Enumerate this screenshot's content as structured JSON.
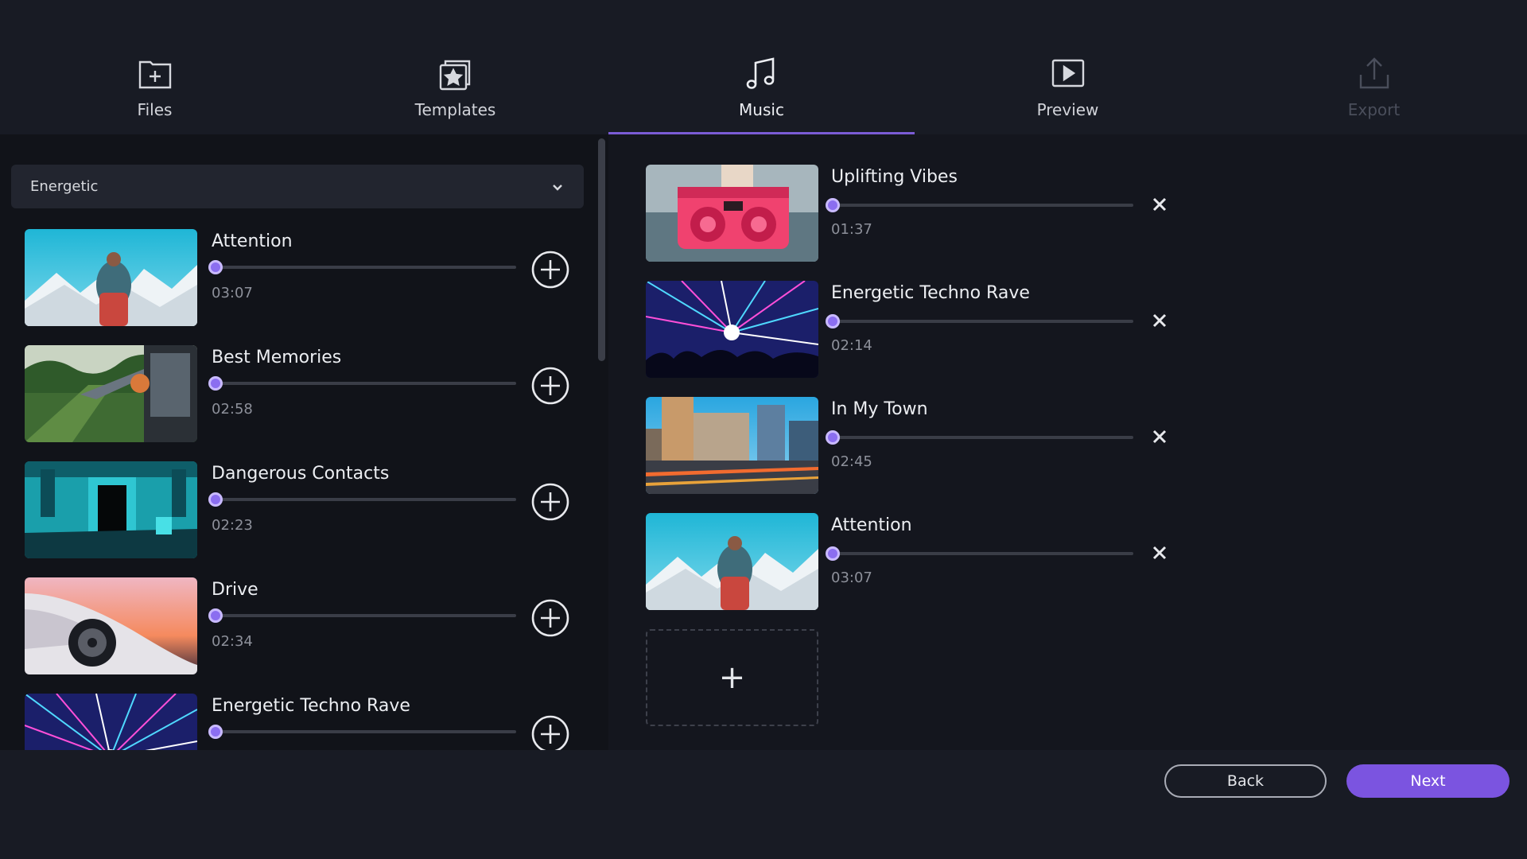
{
  "tabs": [
    {
      "label": "Files",
      "icon": "file-add-icon",
      "state": "normal"
    },
    {
      "label": "Templates",
      "icon": "template-star-icon",
      "state": "normal"
    },
    {
      "label": "Music",
      "icon": "music-note-icon",
      "state": "active"
    },
    {
      "label": "Preview",
      "icon": "play-icon",
      "state": "normal"
    },
    {
      "label": "Export",
      "icon": "upload-icon",
      "state": "disabled"
    }
  ],
  "genre_dropdown": {
    "selected": "Energetic",
    "icon": "chevron-down-icon"
  },
  "library": [
    {
      "title": "Attention",
      "duration": "03:07",
      "progress": 0,
      "thumb": "mountain-hiker"
    },
    {
      "title": "Best Memories",
      "duration": "02:58",
      "progress": 0,
      "thumb": "train-forest"
    },
    {
      "title": "Dangerous Contacts",
      "duration": "02:23",
      "progress": 0,
      "thumb": "cyan-ruins"
    },
    {
      "title": "Drive",
      "duration": "02:34",
      "progress": 0,
      "thumb": "sports-car"
    },
    {
      "title": "Energetic Techno Rave",
      "duration": "",
      "progress": 0,
      "thumb": "laser-rave"
    }
  ],
  "selected": [
    {
      "title": "Uplifting Vibes",
      "duration": "01:37",
      "progress": 0,
      "thumb": "pink-boombox"
    },
    {
      "title": "Energetic Techno Rave",
      "duration": "02:14",
      "progress": 0,
      "thumb": "laser-rave"
    },
    {
      "title": "In My Town",
      "duration": "02:45",
      "progress": 0,
      "thumb": "city-street"
    },
    {
      "title": "Attention",
      "duration": "03:07",
      "progress": 0,
      "thumb": "mountain-hiker"
    }
  ],
  "add_slot": {
    "symbol": "+"
  },
  "footer": {
    "back_label": "Back",
    "next_label": "Next"
  },
  "colors": {
    "accent": "#7b54e0",
    "knob": "#8b6ef0",
    "background": "#14161e",
    "panel": "#111319"
  }
}
